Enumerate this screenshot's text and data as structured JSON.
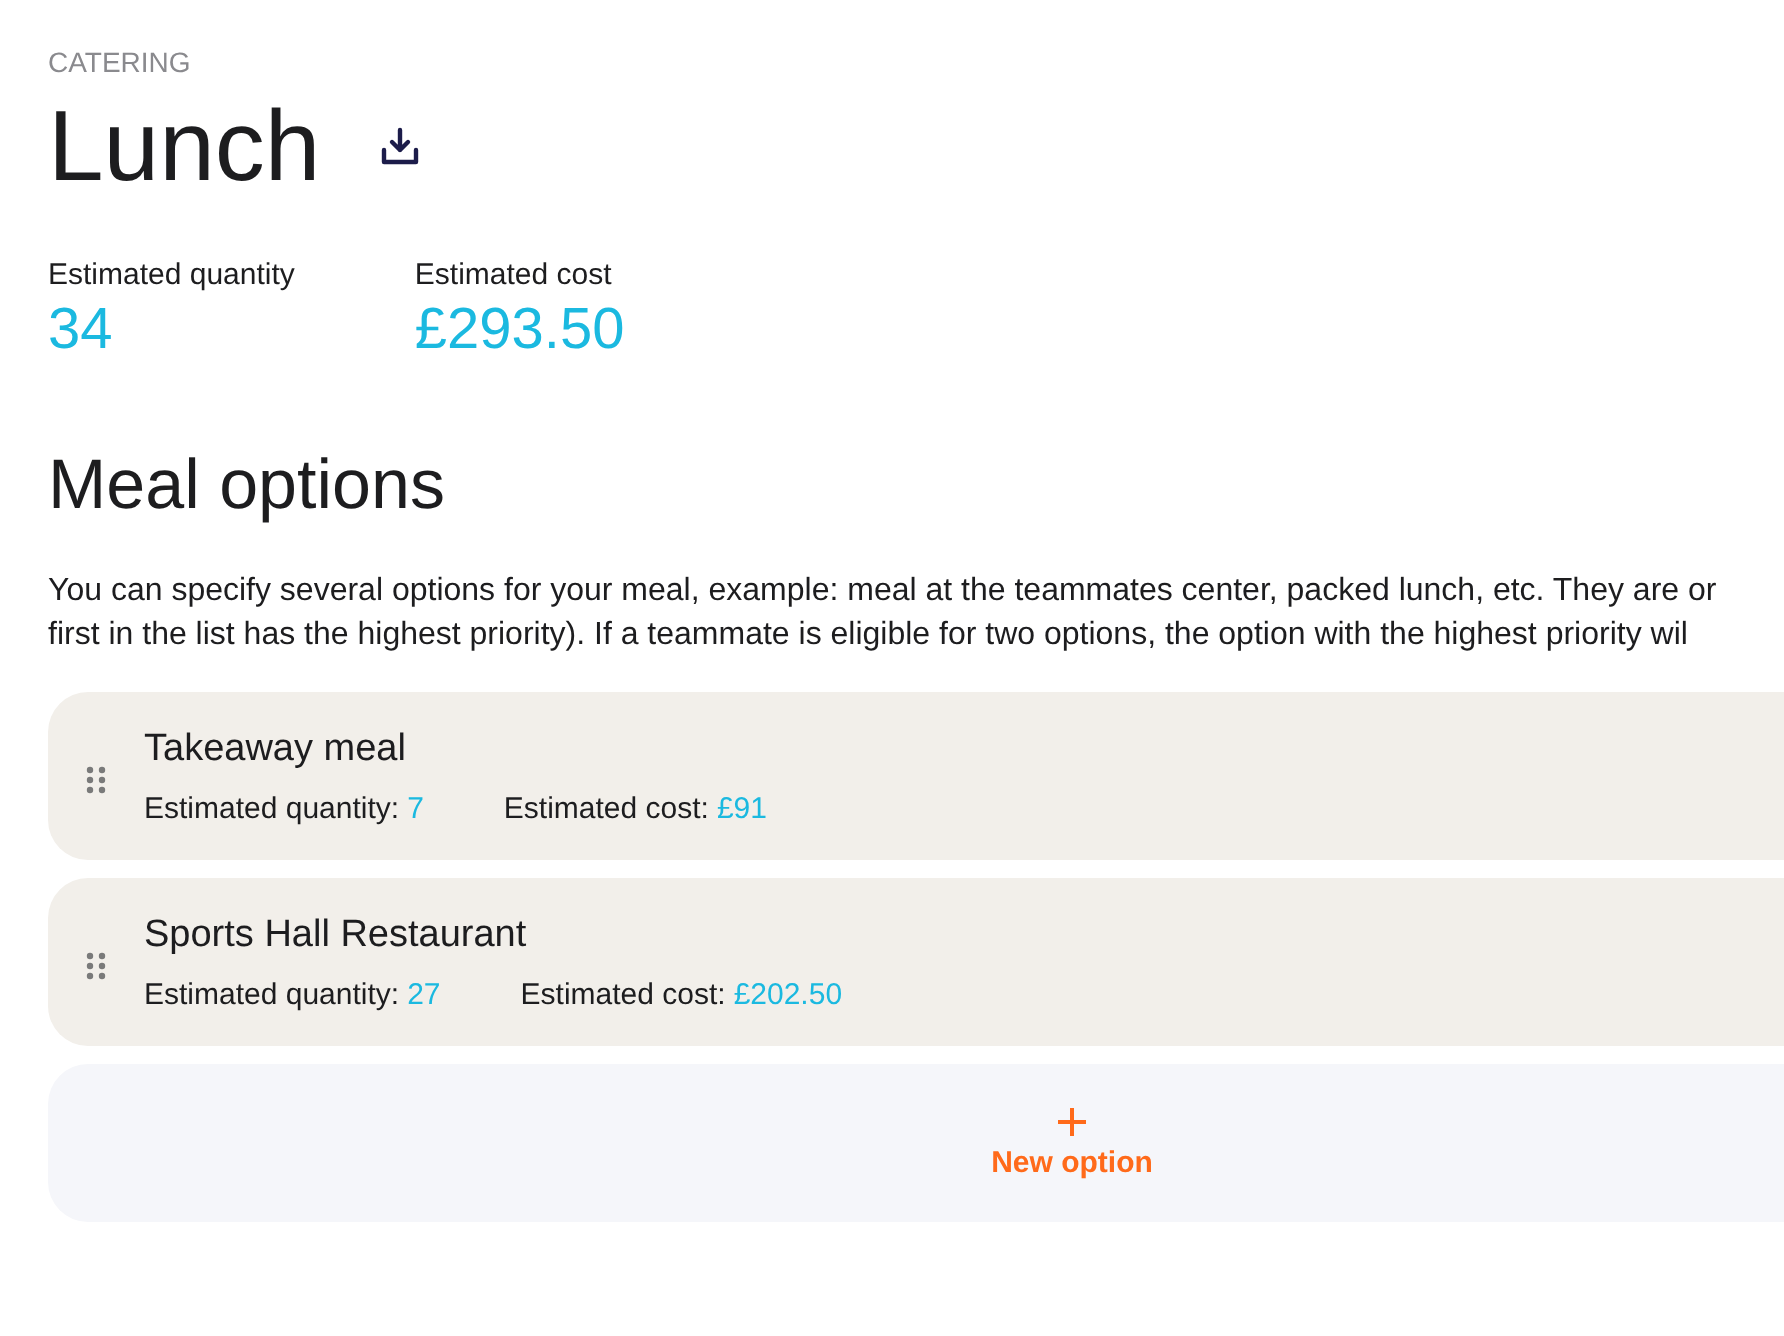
{
  "header": {
    "section": "CATERING",
    "title": "Lunch"
  },
  "stats": [
    {
      "label": "Estimated quantity",
      "value": "34"
    },
    {
      "label": "Estimated cost",
      "value": "£293.50"
    }
  ],
  "meal_options": {
    "title": "Meal options",
    "description_lines": [
      "You can specify several options for your meal, example: meal at the teammates center, packed lunch, etc. They are or",
      "first in the list has the highest priority). If a teammate is eligible for two options, the option with the highest priority wil"
    ],
    "options": [
      {
        "name": "Takeaway meal",
        "quantity_label": "Estimated quantity:",
        "quantity": "7",
        "cost_label": "Estimated cost:",
        "cost": "£91"
      },
      {
        "name": "Sports Hall Restaurant",
        "quantity_label": "Estimated quantity:",
        "quantity": "27",
        "cost_label": "Estimated cost:",
        "cost": "£202.50"
      }
    ],
    "new_option": {
      "label": "New option"
    }
  }
}
